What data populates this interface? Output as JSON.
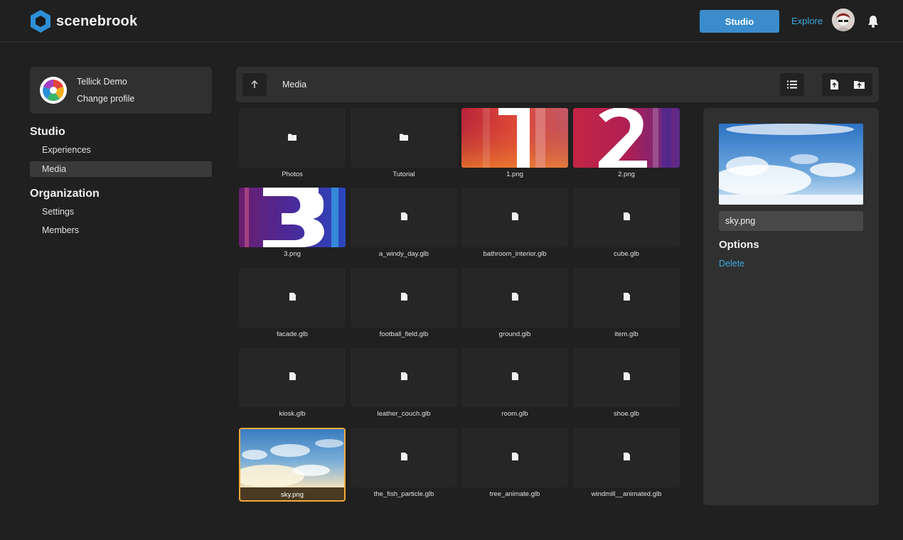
{
  "header": {
    "brand": "scenebrook",
    "studio_label": "Studio",
    "explore_label": "Explore"
  },
  "sidebar": {
    "profile": {
      "name": "Tellick Demo",
      "change_label": "Change profile"
    },
    "sections": [
      {
        "title": "Studio",
        "items": [
          {
            "label": "Experiences",
            "active": false
          },
          {
            "label": "Media",
            "active": true
          }
        ]
      },
      {
        "title": "Organization",
        "items": [
          {
            "label": "Settings",
            "active": false
          },
          {
            "label": "Members",
            "active": false
          }
        ]
      }
    ]
  },
  "toolbar": {
    "title": "Media"
  },
  "files": [
    {
      "name": "Photos",
      "type": "folder"
    },
    {
      "name": "Tutorial",
      "type": "folder"
    },
    {
      "name": "1.png",
      "type": "image",
      "art": "one"
    },
    {
      "name": "2.png",
      "type": "image",
      "art": "two"
    },
    {
      "name": "3.png",
      "type": "image",
      "art": "three"
    },
    {
      "name": "a_windy_day.glb",
      "type": "file"
    },
    {
      "name": "bathroom_interior.glb",
      "type": "file"
    },
    {
      "name": "cube.glb",
      "type": "file"
    },
    {
      "name": "facade.glb",
      "type": "file"
    },
    {
      "name": "football_field.glb",
      "type": "file"
    },
    {
      "name": "ground.glb",
      "type": "file"
    },
    {
      "name": "item.glb",
      "type": "file"
    },
    {
      "name": "kiosk.glb",
      "type": "file"
    },
    {
      "name": "leather_couch.glb",
      "type": "file"
    },
    {
      "name": "room.glb",
      "type": "file"
    },
    {
      "name": "shoe.glb",
      "type": "file"
    },
    {
      "name": "sky.png",
      "type": "image",
      "art": "sky",
      "selected": true
    },
    {
      "name": "the_fish_particle.glb",
      "type": "file"
    },
    {
      "name": "tree_animate.glb",
      "type": "file"
    },
    {
      "name": "windmill__animated.glb",
      "type": "file"
    }
  ],
  "details": {
    "filename": "sky.png",
    "options_title": "Options",
    "delete_label": "Delete"
  },
  "colors": {
    "accent": "#3a8ccc",
    "link": "#3aa8dc",
    "selection": "#f2a93b",
    "background": "#202020",
    "panel": "#303030"
  }
}
